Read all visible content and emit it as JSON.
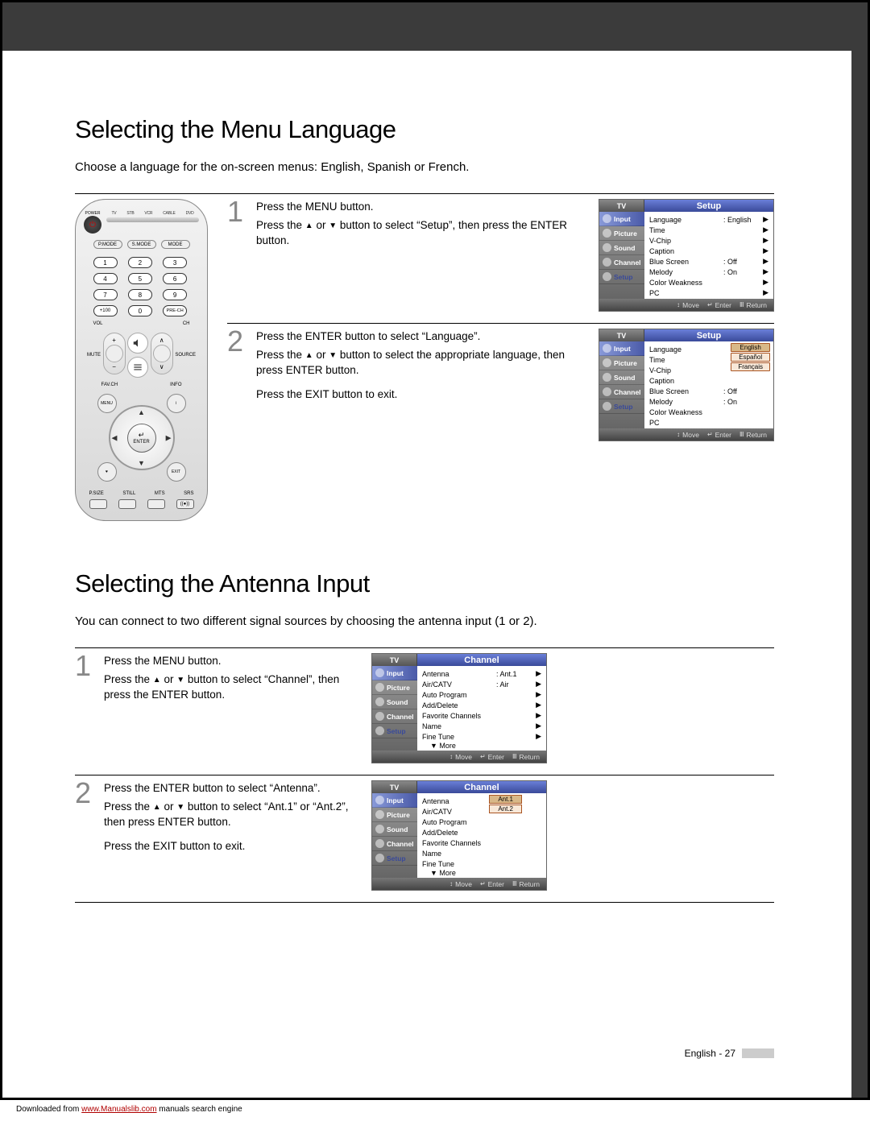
{
  "page_footer": {
    "label": "English - 27"
  },
  "download_line": {
    "prefix": "Downloaded from ",
    "link": "www.Manualslib.com",
    "suffix": " manuals search engine"
  },
  "section1": {
    "heading": "Selecting the Menu Language",
    "intro": "Choose a language for the on-screen menus: English, Spanish or French.",
    "step1_num": "1",
    "step1_a": "Press the MENU button.",
    "step1_b_pre": "Press the ",
    "step1_b_mid": " or ",
    "step1_b_post": " button to select “Setup”, then press the ENTER button.",
    "step2_num": "2",
    "step2_a": "Press the ENTER button to select “Language”.",
    "step2_b_pre": "Press the ",
    "step2_b_mid": " or ",
    "step2_b_post": " button to select the appropriate language, then press ENTER button.",
    "step2_c": "Press the EXIT button to exit."
  },
  "section2": {
    "heading": "Selecting the Antenna Input",
    "intro": "You can connect to two different signal sources by choosing the antenna input (1 or 2).",
    "step1_num": "1",
    "step1_a": "Press the MENU button.",
    "step1_b_pre": "Press the ",
    "step1_b_mid": " or ",
    "step1_b_post": " button to select “Channel”, then press the ENTER button.",
    "step2_num": "2",
    "step2_a": "Press the ENTER button to select “Antenna”.",
    "step2_b_pre": "Press the ",
    "step2_b_mid": " or ",
    "step2_b_post": " button to select “Ant.1” or “Ant.2”, then press ENTER button.",
    "step2_c": "Press the EXIT button to exit."
  },
  "remote": {
    "power": "POWER",
    "top_labels": [
      "TV",
      "STB",
      "VCR",
      "CABLE",
      "DVD"
    ],
    "pills": [
      "P.MODE",
      "S.MODE",
      "MODE"
    ],
    "numpad": [
      "1",
      "2",
      "3",
      "4",
      "5",
      "6",
      "7",
      "8",
      "9",
      "+100",
      "0",
      "PRE-CH"
    ],
    "vol": "VOL",
    "ch": "CH",
    "mute": "MUTE",
    "source": "SOURCE",
    "favch": "FAV.CH",
    "info": "INFO",
    "menu": "MENU",
    "exit": "EXIT",
    "enter": "ENTER",
    "bottom": [
      "P.SIZE",
      "STILL",
      "MTS",
      "SRS"
    ]
  },
  "osd_side_items": [
    "Input",
    "Picture",
    "Sound",
    "Channel",
    "Setup"
  ],
  "osd_setup": {
    "title": "Setup",
    "tv": "TV",
    "rows": [
      {
        "lab": "Language",
        "val": ": English"
      },
      {
        "lab": "Time",
        "val": ""
      },
      {
        "lab": "V-Chip",
        "val": ""
      },
      {
        "lab": "Caption",
        "val": ""
      },
      {
        "lab": "Blue Screen",
        "val": ": Off"
      },
      {
        "lab": "Melody",
        "val": ": On"
      },
      {
        "lab": "Color Weakness",
        "val": ""
      },
      {
        "lab": "PC",
        "val": ""
      }
    ],
    "footer": {
      "move": "Move",
      "enter": "Enter",
      "return": "Return"
    }
  },
  "osd_setup_lang": {
    "title": "Setup",
    "tv": "TV",
    "options": [
      "English",
      "Español",
      "Français"
    ]
  },
  "osd_channel": {
    "title": "Channel",
    "tv": "TV",
    "rows": [
      {
        "lab": "Antenna",
        "val": ": Ant.1"
      },
      {
        "lab": "Air/CATV",
        "val": ": Air"
      },
      {
        "lab": "Auto Program",
        "val": ""
      },
      {
        "lab": "Add/Delete",
        "val": ""
      },
      {
        "lab": "Favorite Channels",
        "val": ""
      },
      {
        "lab": "Name",
        "val": ""
      },
      {
        "lab": "Fine Tune",
        "val": ""
      }
    ],
    "more": "▼ More",
    "footer": {
      "move": "Move",
      "enter": "Enter",
      "return": "Return"
    }
  },
  "osd_channel_ant": {
    "title": "Channel",
    "tv": "TV",
    "options": [
      "Ant.1",
      "Ant.2"
    ]
  },
  "glyphs": {
    "up": "▲",
    "down": "▼",
    "updown": "↕",
    "enter_sym": "↵",
    "return_sym": "⤶",
    "caret": "▶"
  }
}
